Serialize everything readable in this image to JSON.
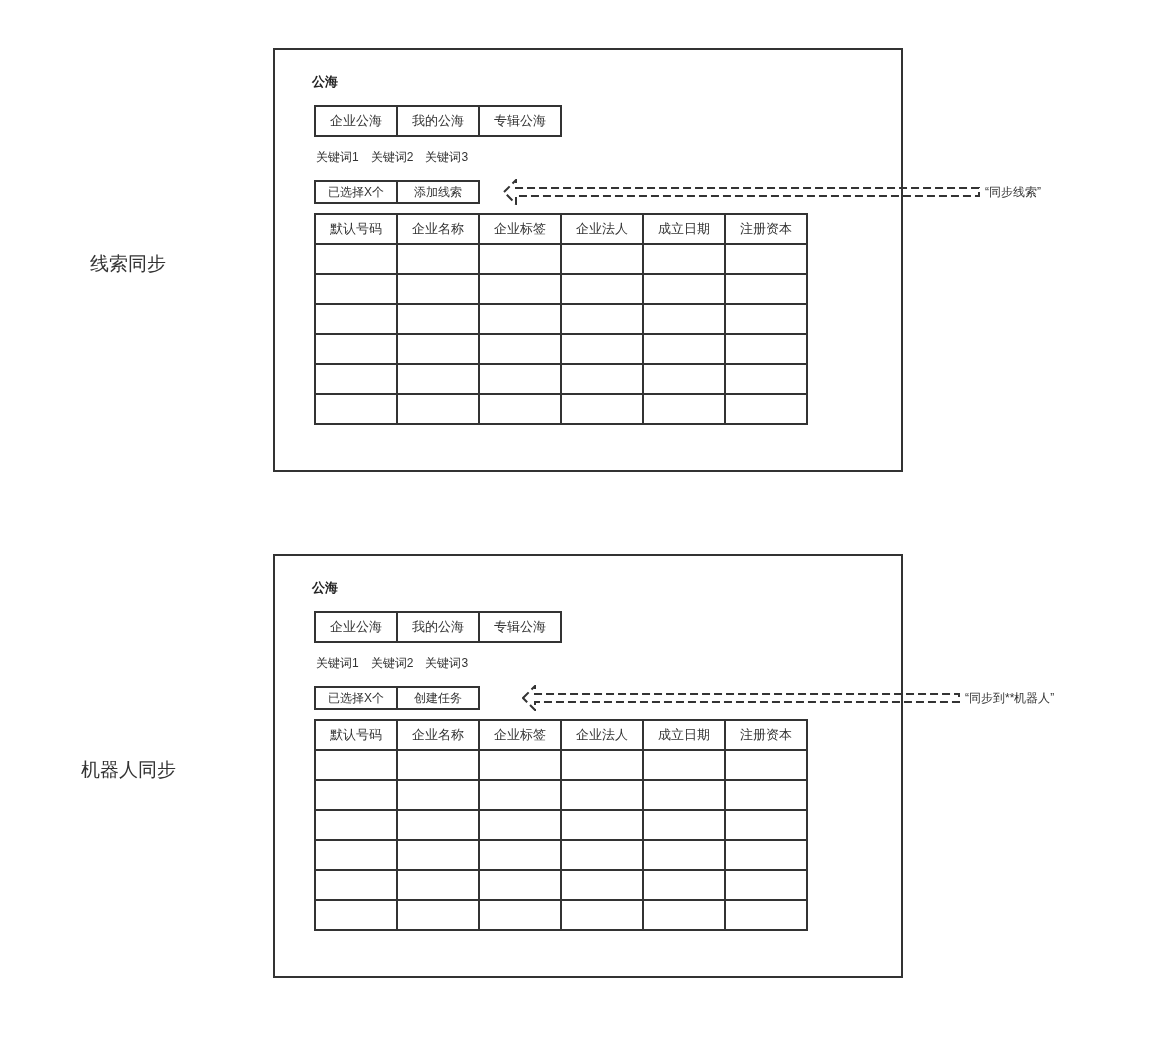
{
  "sections": [
    {
      "label": "线索同步",
      "panel": {
        "title": "公海",
        "tabs": [
          {
            "label": "企业公海",
            "selected": false
          },
          {
            "label": "我的公海",
            "selected": false
          },
          {
            "label": "专辑公海",
            "selected": false
          }
        ],
        "keywords": [
          "关键词1",
          "关键词2",
          "关键词3"
        ],
        "actions": [
          "已选择X个",
          "添加线索"
        ],
        "annotation": "“同步线索”",
        "table": {
          "columns": [
            "默认号码",
            "企业名称",
            "企业标签",
            "企业法人",
            "成立日期",
            "注册资本"
          ],
          "rows": [
            {},
            {},
            {},
            {},
            {},
            {}
          ]
        }
      }
    },
    {
      "label": "机器人同步",
      "panel": {
        "title": "公海",
        "tabs": [
          {
            "label": "企业公海",
            "selected": false
          },
          {
            "label": "我的公海",
            "selected": false
          },
          {
            "label": "专辑公海",
            "selected": false
          }
        ],
        "keywords": [
          "关键词1",
          "关键词2",
          "关键词3"
        ],
        "actions": [
          "已选择X个",
          "创建任务"
        ],
        "annotation": "“同步到**机器人”",
        "table": {
          "columns": [
            "默认号码",
            "企业名称",
            "企业标签",
            "企业法人",
            "成立日期",
            "注册资本"
          ],
          "rows": [
            {},
            {},
            {},
            {},
            {},
            {}
          ]
        }
      }
    }
  ]
}
